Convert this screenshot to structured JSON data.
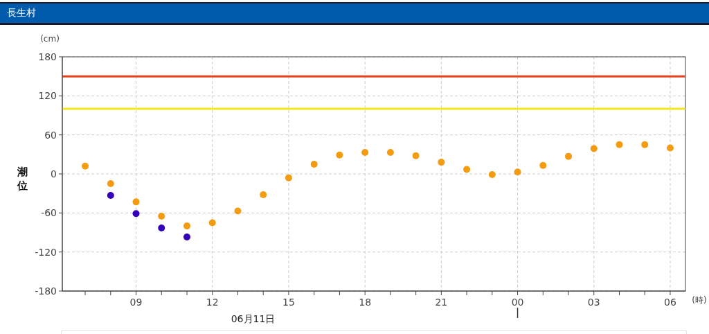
{
  "header": {
    "title": "長生村"
  },
  "chart": {
    "y_unit": "(cm)",
    "x_unit": "(時)",
    "chart_data": {
      "type": "scatter",
      "ylabel": "潮位",
      "x": [
        7,
        8,
        9,
        10,
        11,
        12,
        13,
        14,
        15,
        16,
        17,
        18,
        19,
        20,
        21,
        22,
        23,
        24,
        25,
        26,
        27,
        28,
        29,
        30
      ],
      "xlim": [
        6.1,
        30.6
      ],
      "xticks": [
        {
          "value": 9,
          "label": "09"
        },
        {
          "value": 12,
          "label": "12"
        },
        {
          "value": 15,
          "label": "15"
        },
        {
          "value": 18,
          "label": "18"
        },
        {
          "value": 21,
          "label": "21"
        }
      ],
      "series": [
        {
          "color": "#f39c12",
          "values": [
            12,
            -15,
            -43,
            -65,
            -80,
            -75,
            -57,
            -32,
            -6,
            15,
            29,
            33,
            33,
            28,
            18,
            7,
            -1,
            3,
            13,
            27,
            39,
            45,
            45,
            40
          ]
        },
        {
          "color": "#3300bb",
          "values": [
            null,
            -33,
            -61,
            -83,
            -97,
            null,
            null,
            null,
            null,
            null,
            null,
            null,
            null,
            null,
            null,
            null,
            null,
            null,
            null,
            null,
            null,
            null,
            null,
            null
          ]
        }
      ],
      "ylim": [
        -180,
        180
      ],
      "yticks": [
        180,
        120,
        60,
        0,
        -60,
        -120,
        -180
      ],
      "grid": true,
      "ref_lines": [
        {
          "axis": "y",
          "value": 150,
          "color": "#e8401c"
        },
        {
          "axis": "y",
          "value": 100,
          "color": "#f2e81e"
        }
      ]
    },
    "next_day_tick_labels": [
      "00",
      "03",
      "06"
    ],
    "date_label": "06月11日"
  }
}
